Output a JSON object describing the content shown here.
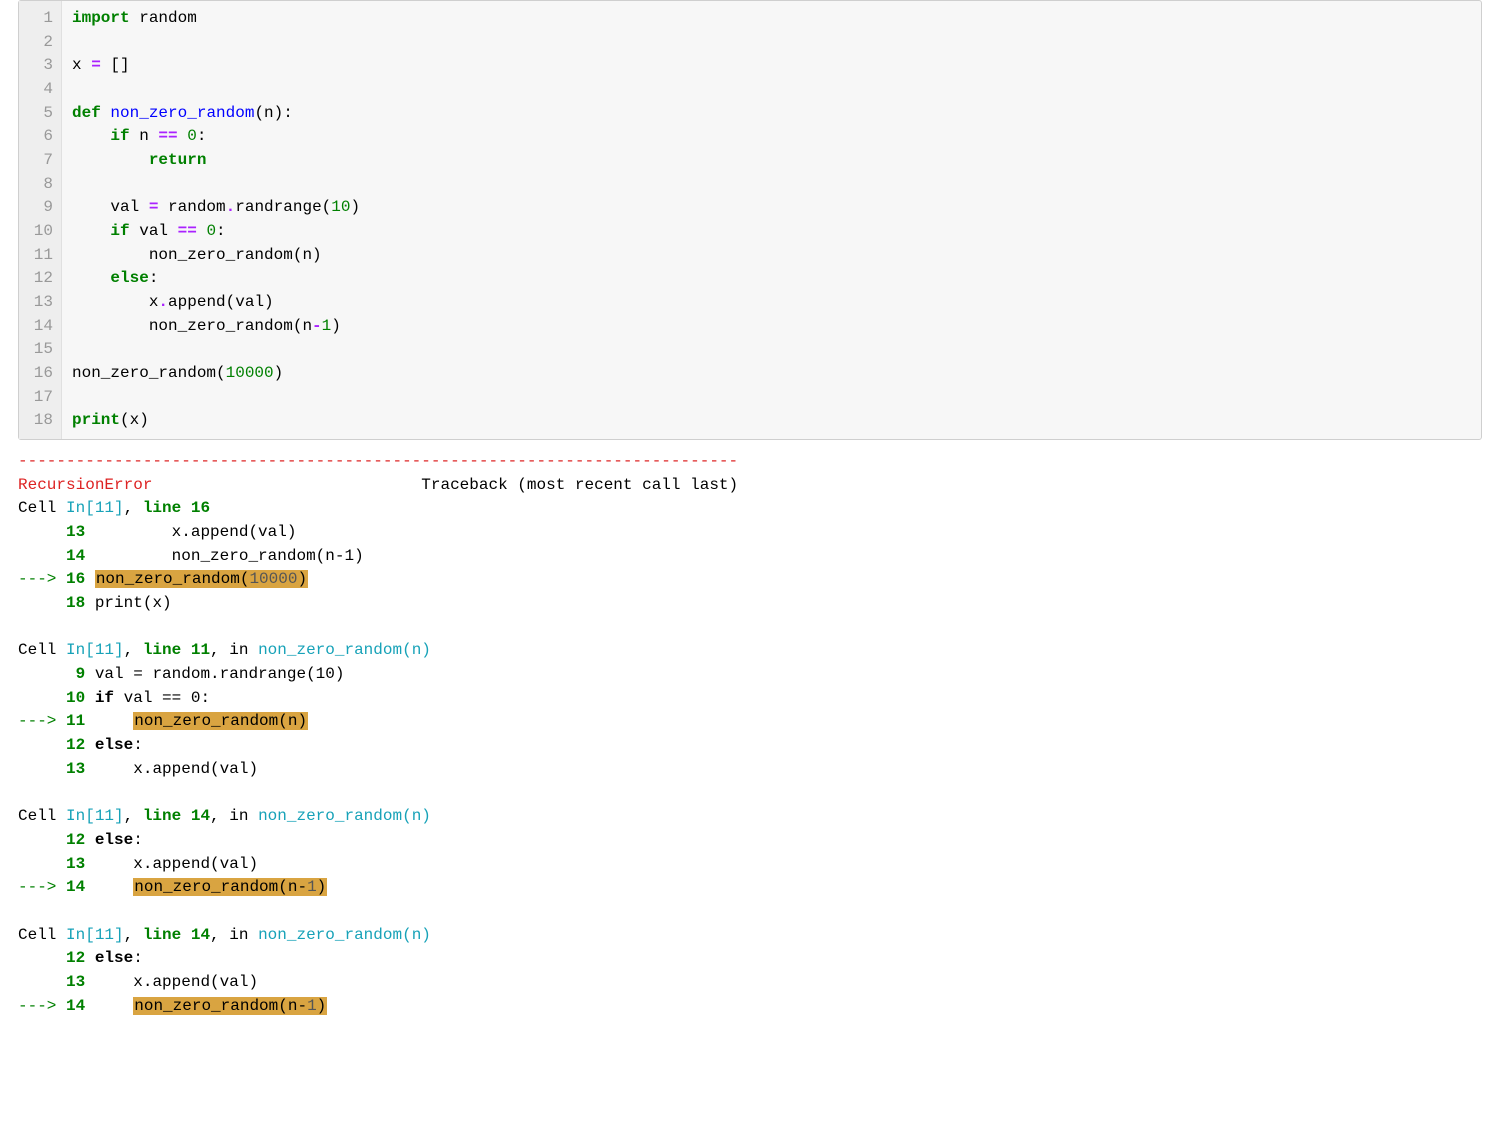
{
  "code": {
    "gutter": [
      "1",
      "2",
      "3",
      "4",
      "5",
      "6",
      "7",
      "8",
      "9",
      "10",
      "11",
      "12",
      "13",
      "14",
      "15",
      "16",
      "17",
      "18"
    ],
    "lines": [
      {
        "tokens": [
          {
            "t": "import",
            "c": "kw"
          },
          {
            "t": " random",
            "c": "nm"
          }
        ]
      },
      {
        "tokens": [
          {
            "t": "",
            "c": "nm"
          }
        ]
      },
      {
        "tokens": [
          {
            "t": "x ",
            "c": "nm"
          },
          {
            "t": "=",
            "c": "op"
          },
          {
            "t": " []",
            "c": "nm"
          }
        ]
      },
      {
        "tokens": [
          {
            "t": "",
            "c": "nm"
          }
        ]
      },
      {
        "tokens": [
          {
            "t": "def",
            "c": "kw"
          },
          {
            "t": " ",
            "c": "nm"
          },
          {
            "t": "non_zero_random",
            "c": "fn"
          },
          {
            "t": "(n):",
            "c": "nm"
          }
        ]
      },
      {
        "tokens": [
          {
            "t": "    ",
            "c": "nm"
          },
          {
            "t": "if",
            "c": "kw"
          },
          {
            "t": " n ",
            "c": "nm"
          },
          {
            "t": "==",
            "c": "op"
          },
          {
            "t": " ",
            "c": "nm"
          },
          {
            "t": "0",
            "c": "num"
          },
          {
            "t": ":",
            "c": "nm"
          }
        ]
      },
      {
        "tokens": [
          {
            "t": "        ",
            "c": "nm"
          },
          {
            "t": "return",
            "c": "kw"
          }
        ]
      },
      {
        "tokens": [
          {
            "t": "",
            "c": "nm"
          }
        ]
      },
      {
        "tokens": [
          {
            "t": "    val ",
            "c": "nm"
          },
          {
            "t": "=",
            "c": "op"
          },
          {
            "t": " random",
            "c": "nm"
          },
          {
            "t": ".",
            "c": "op"
          },
          {
            "t": "randrange(",
            "c": "nm"
          },
          {
            "t": "10",
            "c": "num"
          },
          {
            "t": ")",
            "c": "nm"
          }
        ]
      },
      {
        "tokens": [
          {
            "t": "    ",
            "c": "nm"
          },
          {
            "t": "if",
            "c": "kw"
          },
          {
            "t": " val ",
            "c": "nm"
          },
          {
            "t": "==",
            "c": "op"
          },
          {
            "t": " ",
            "c": "nm"
          },
          {
            "t": "0",
            "c": "num"
          },
          {
            "t": ":",
            "c": "nm"
          }
        ]
      },
      {
        "tokens": [
          {
            "t": "        non_zero_random(n)",
            "c": "nm"
          }
        ]
      },
      {
        "tokens": [
          {
            "t": "    ",
            "c": "nm"
          },
          {
            "t": "else",
            "c": "kw"
          },
          {
            "t": ":",
            "c": "nm"
          }
        ]
      },
      {
        "tokens": [
          {
            "t": "        x",
            "c": "nm"
          },
          {
            "t": ".",
            "c": "op"
          },
          {
            "t": "append(val)",
            "c": "nm"
          }
        ]
      },
      {
        "tokens": [
          {
            "t": "        non_zero_random(n",
            "c": "nm"
          },
          {
            "t": "-",
            "c": "op"
          },
          {
            "t": "1",
            "c": "num"
          },
          {
            "t": ")",
            "c": "nm"
          }
        ]
      },
      {
        "tokens": [
          {
            "t": "",
            "c": "nm"
          }
        ]
      },
      {
        "tokens": [
          {
            "t": "non_zero_random(",
            "c": "nm"
          },
          {
            "t": "10000",
            "c": "num"
          },
          {
            "t": ")",
            "c": "nm"
          }
        ]
      },
      {
        "tokens": [
          {
            "t": "",
            "c": "nm"
          }
        ]
      },
      {
        "tokens": [
          {
            "t": "print",
            "c": "kw"
          },
          {
            "t": "(x)",
            "c": "nm"
          }
        ]
      }
    ]
  },
  "output": {
    "dashes": "---------------------------------------------------------------------------",
    "err_name": "RecursionError",
    "header_spacer": "                            ",
    "traceback_label": "Traceback (most recent call last)",
    "frames": [
      {
        "head": {
          "pre": "Cell ",
          "cell": "In[11]",
          "mid": ", ",
          "line_label": "line 16"
        },
        "lines": [
          {
            "arrow": false,
            "ln": "13",
            "pad": "         ",
            "text": "x.append(val)"
          },
          {
            "arrow": false,
            "ln": "14",
            "pad": "         ",
            "text": "non_zero_random(n-1)"
          },
          {
            "arrow": true,
            "ln": "16",
            "pad": " ",
            "hl_pre": "non_zero_random(",
            "hl_num": "10000",
            "hl_post": ")"
          },
          {
            "arrow": false,
            "ln": "18",
            "pad": " ",
            "text": "print(x)"
          }
        ]
      },
      {
        "head": {
          "pre": "Cell ",
          "cell": "In[11]",
          "mid": ", ",
          "line_label": "line 11",
          "in_text": ", in ",
          "func": "non_zero_random(n)"
        },
        "lines": [
          {
            "arrow": false,
            "ln": "9",
            "pad": " ",
            "text": "val = random.randrange(10)"
          },
          {
            "arrow": false,
            "ln": "10",
            "pad": " ",
            "bold_pre": "if",
            "text_after": " val == 0:"
          },
          {
            "arrow": true,
            "ln": "11",
            "pad": "     ",
            "hl_pre": "non_zero_random(n)",
            "hl_num": "",
            "hl_post": ""
          },
          {
            "arrow": false,
            "ln": "12",
            "pad": " ",
            "bold_pre": "else",
            "text_after": ":"
          },
          {
            "arrow": false,
            "ln": "13",
            "pad": "     ",
            "text": "x.append(val)"
          }
        ]
      },
      {
        "head": {
          "pre": "Cell ",
          "cell": "In[11]",
          "mid": ", ",
          "line_label": "line 14",
          "in_text": ", in ",
          "func": "non_zero_random(n)"
        },
        "lines": [
          {
            "arrow": false,
            "ln": "12",
            "pad": " ",
            "bold_pre": "else",
            "text_after": ":"
          },
          {
            "arrow": false,
            "ln": "13",
            "pad": "     ",
            "text": "x.append(val)"
          },
          {
            "arrow": true,
            "ln": "14",
            "pad": "     ",
            "hl_pre": "non_zero_random(n-",
            "hl_num": "1",
            "hl_post": ")"
          }
        ]
      },
      {
        "head": {
          "pre": "Cell ",
          "cell": "In[11]",
          "mid": ", ",
          "line_label": "line 14",
          "in_text": ", in ",
          "func": "non_zero_random(n)"
        },
        "lines": [
          {
            "arrow": false,
            "ln": "12",
            "pad": " ",
            "bold_pre": "else",
            "text_after": ":"
          },
          {
            "arrow": false,
            "ln": "13",
            "pad": "     ",
            "text": "x.append(val)"
          },
          {
            "arrow": true,
            "ln": "14",
            "pad": "     ",
            "hl_pre": "non_zero_random(n-",
            "hl_num": "1",
            "hl_post": ")"
          }
        ]
      }
    ]
  }
}
